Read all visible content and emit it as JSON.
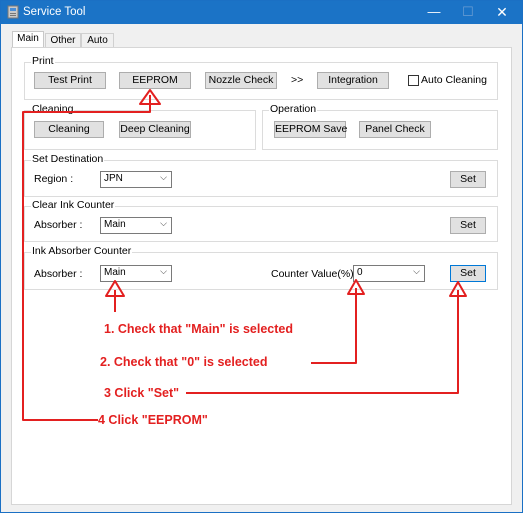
{
  "window": {
    "title": "Service Tool",
    "minimize_glyph": "—",
    "maximize_glyph": "☐",
    "close_glyph": "✕"
  },
  "tabs": [
    {
      "label": "Main",
      "active": true
    },
    {
      "label": "Other",
      "active": false
    },
    {
      "label": "Auto",
      "active": false
    }
  ],
  "print": {
    "title": "Print",
    "test_print": "Test Print",
    "eeprom": "EEPROM",
    "nozzle_check": "Nozzle Check",
    "separator": ">>",
    "integration": "Integration",
    "auto_cleaning_label": "Auto Cleaning",
    "auto_cleaning_checked": false
  },
  "cleaning": {
    "title": "Cleaning",
    "cleaning": "Cleaning",
    "deep_cleaning": "Deep Cleaning"
  },
  "operation": {
    "title": "Operation",
    "eeprom_save": "EEPROM Save",
    "panel_check": "Panel Check"
  },
  "set_destination": {
    "title": "Set Destination",
    "region_label": "Region :",
    "region_value": "JPN",
    "set": "Set"
  },
  "clear_ink_counter": {
    "title": "Clear Ink Counter",
    "absorber_label": "Absorber :",
    "absorber_value": "Main",
    "set": "Set"
  },
  "ink_absorber_counter": {
    "title": "Ink Absorber Counter",
    "absorber_label": "Absorber :",
    "absorber_value": "Main",
    "counter_label": "Counter Value(%) :",
    "counter_value": "0",
    "set": "Set"
  },
  "annotations": {
    "step1": "1. Check that \"Main\" is selected",
    "step2": "2. Check that \"0\" is selected",
    "step3": "3 Click \"Set\"",
    "step4": "4 Click \"EEPROM\"",
    "color": "#e32020"
  },
  "colors": {
    "titlebar": "#1b73c6",
    "focus_border": "#0078d7",
    "annotation": "#e32020"
  }
}
